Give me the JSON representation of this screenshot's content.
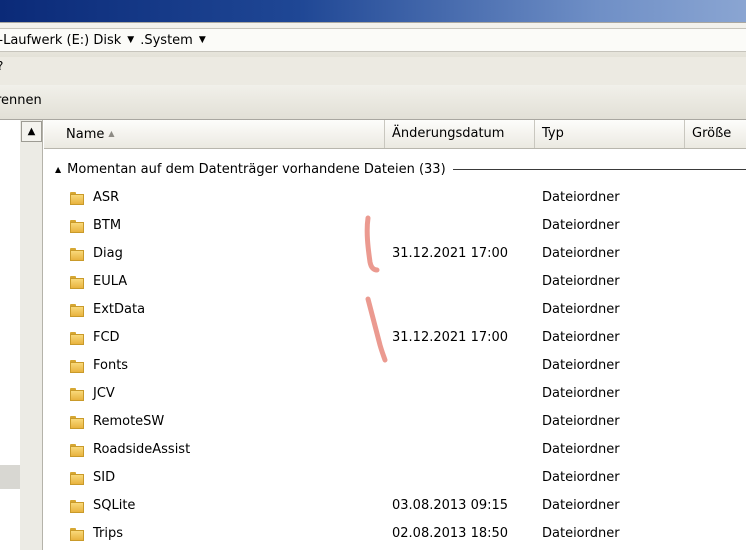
{
  "address": {
    "crumbs": [
      {
        "label": "/-Laufwerk (E:) Disk"
      },
      {
        "label": ".System"
      }
    ]
  },
  "menubar": {
    "fragment": "?"
  },
  "toolbar": {
    "fragment": "rennen"
  },
  "columns": {
    "name": "Name",
    "date": "Änderungsdatum",
    "type": "Typ",
    "size": "Größe"
  },
  "group": {
    "label": "Momentan auf dem Datenträger vorhandene Dateien (33)"
  },
  "files": [
    {
      "name": "ASR",
      "date": "",
      "type": "Dateiordner"
    },
    {
      "name": "BTM",
      "date": "",
      "type": "Dateiordner"
    },
    {
      "name": "Diag",
      "date": "31.12.2021 17:00",
      "type": "Dateiordner"
    },
    {
      "name": "EULA",
      "date": "",
      "type": "Dateiordner"
    },
    {
      "name": "ExtData",
      "date": "",
      "type": "Dateiordner"
    },
    {
      "name": "FCD",
      "date": "31.12.2021 17:00",
      "type": "Dateiordner"
    },
    {
      "name": "Fonts",
      "date": "",
      "type": "Dateiordner"
    },
    {
      "name": "JCV",
      "date": "",
      "type": "Dateiordner"
    },
    {
      "name": "RemoteSW",
      "date": "",
      "type": "Dateiordner"
    },
    {
      "name": "RoadsideAssist",
      "date": "",
      "type": "Dateiordner"
    },
    {
      "name": "SID",
      "date": "",
      "type": "Dateiordner"
    },
    {
      "name": "SQLite",
      "date": "03.08.2013 09:15",
      "type": "Dateiordner"
    },
    {
      "name": "Trips",
      "date": "02.08.2013 18:50",
      "type": "Dateiordner"
    }
  ],
  "colors": {
    "folder": "#f0c85a",
    "scribble": "#e8887c"
  }
}
